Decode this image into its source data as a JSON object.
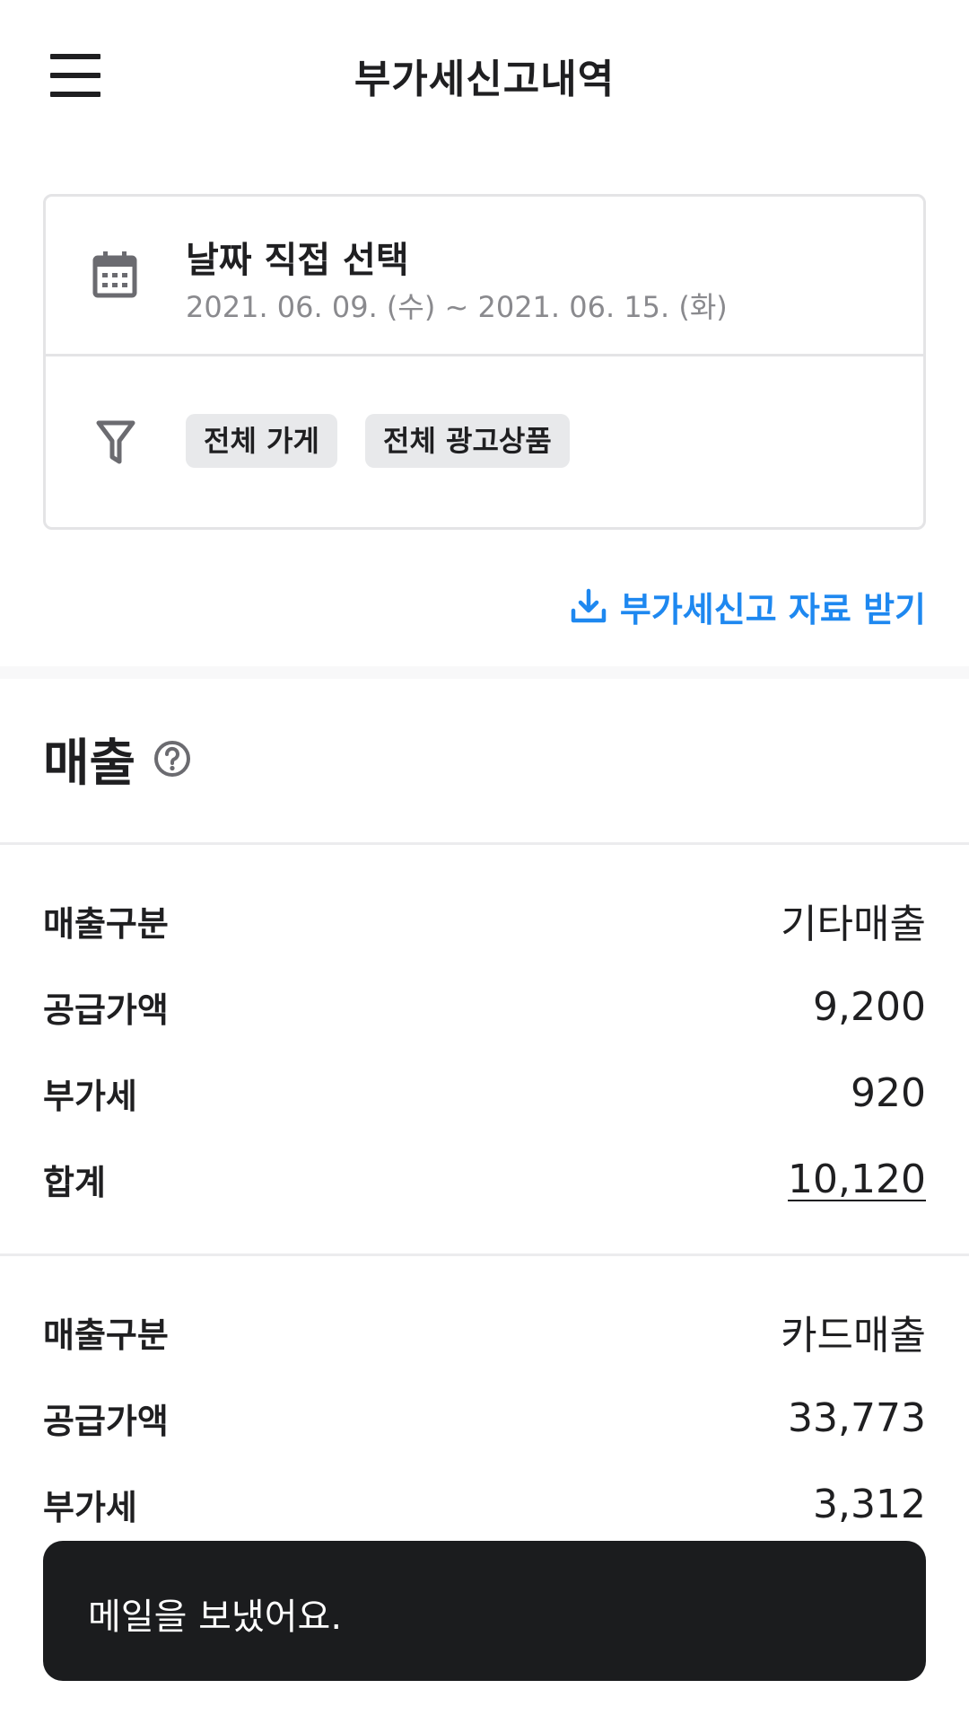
{
  "header": {
    "title": "부가세신고내역",
    "menu_icon": "menu-icon"
  },
  "filter": {
    "date_label": "날짜 직접 선택",
    "date_range": "2021. 06. 09. (수) ~ 2021. 06. 15. (화)",
    "calendar_icon": "calendar-icon",
    "filter_icon": "filter-icon",
    "chips": [
      "전체 가게",
      "전체 광고상품"
    ]
  },
  "download": {
    "label": "부가세신고 자료 받기",
    "icon": "download-icon",
    "color": "#1e88f0"
  },
  "sales": {
    "title": "매출",
    "help_icon": "help-circle-icon",
    "groups": [
      {
        "rows": [
          {
            "label": "매출구분",
            "value": "기타매출"
          },
          {
            "label": "공급가액",
            "value": "9,200"
          },
          {
            "label": "부가세",
            "value": "920"
          },
          {
            "label": "합계",
            "value": "10,120"
          }
        ]
      },
      {
        "rows": [
          {
            "label": "매출구분",
            "value": "카드매출"
          },
          {
            "label": "공급가액",
            "value": "33,773"
          },
          {
            "label": "부가세",
            "value": "3,312"
          }
        ]
      }
    ]
  },
  "toast": {
    "message": "메일을 보냈어요."
  }
}
